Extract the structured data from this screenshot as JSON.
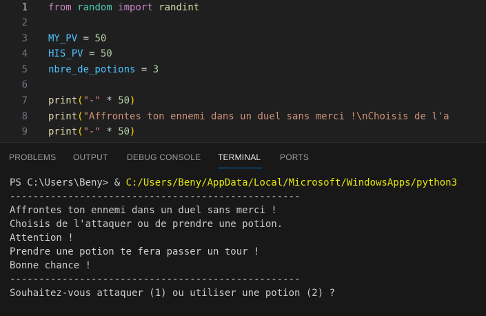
{
  "editor": {
    "lines": [
      {
        "n": "1",
        "tokens": [
          {
            "t": "from",
            "c": "kw"
          },
          {
            "t": " ",
            "c": "op"
          },
          {
            "t": "random",
            "c": "mod"
          },
          {
            "t": " ",
            "c": "op"
          },
          {
            "t": "import",
            "c": "kw"
          },
          {
            "t": " ",
            "c": "op"
          },
          {
            "t": "randint",
            "c": "fn"
          }
        ]
      },
      {
        "n": "2",
        "tokens": []
      },
      {
        "n": "3",
        "tokens": [
          {
            "t": "MY_PV",
            "c": "var"
          },
          {
            "t": " = ",
            "c": "op"
          },
          {
            "t": "50",
            "c": "num"
          }
        ]
      },
      {
        "n": "4",
        "tokens": [
          {
            "t": "HIS_PV",
            "c": "var"
          },
          {
            "t": " = ",
            "c": "op"
          },
          {
            "t": "50",
            "c": "num"
          }
        ]
      },
      {
        "n": "5",
        "tokens": [
          {
            "t": "nbre_de_potions",
            "c": "var"
          },
          {
            "t": " = ",
            "c": "op"
          },
          {
            "t": "3",
            "c": "num"
          }
        ]
      },
      {
        "n": "6",
        "tokens": []
      },
      {
        "n": "7",
        "tokens": [
          {
            "t": "print",
            "c": "fn"
          },
          {
            "t": "(",
            "c": "p1"
          },
          {
            "t": "\"-\"",
            "c": "str"
          },
          {
            "t": " * ",
            "c": "op"
          },
          {
            "t": "50",
            "c": "num"
          },
          {
            "t": ")",
            "c": "p1"
          }
        ]
      },
      {
        "n": "8",
        "tokens": [
          {
            "t": "print",
            "c": "fn"
          },
          {
            "t": "(",
            "c": "p1"
          },
          {
            "t": "\"Affrontes ton ennemi dans un duel sans merci !\\nChoisis de l'a",
            "c": "str"
          }
        ]
      },
      {
        "n": "9",
        "tokens": [
          {
            "t": "print",
            "c": "fn"
          },
          {
            "t": "(",
            "c": "p1"
          },
          {
            "t": "\"-\"",
            "c": "str"
          },
          {
            "t": " * ",
            "c": "op"
          },
          {
            "t": "50",
            "c": "num"
          },
          {
            "t": ")",
            "c": "p1"
          }
        ]
      }
    ]
  },
  "panel": {
    "tabs": [
      {
        "label": "PROBLEMS",
        "active": false
      },
      {
        "label": "OUTPUT",
        "active": false
      },
      {
        "label": "DEBUG CONSOLE",
        "active": false
      },
      {
        "label": "TERMINAL",
        "active": true
      },
      {
        "label": "PORTS",
        "active": false
      }
    ]
  },
  "terminal": {
    "prompt": "PS C:\\Users\\Beny> & ",
    "command_path": "C:/Users/Beny/AppData/Local/Microsoft/WindowsApps/python3",
    "output": [
      "--------------------------------------------------",
      "Affrontes ton ennemi dans un duel sans merci !",
      "Choisis de l'attaquer ou de prendre une potion.",
      "Attention !",
      "Prendre une potion te fera passer un tour !",
      "Bonne chance !",
      "--------------------------------------------------",
      "Souhaitez-vous attaquer (1) ou utiliser une potion (2) ?"
    ]
  },
  "colors": {
    "editor_bg": "#1f1f1f",
    "panel_bg": "#181818",
    "accent": "#0078d4",
    "path": "#e5e510"
  }
}
